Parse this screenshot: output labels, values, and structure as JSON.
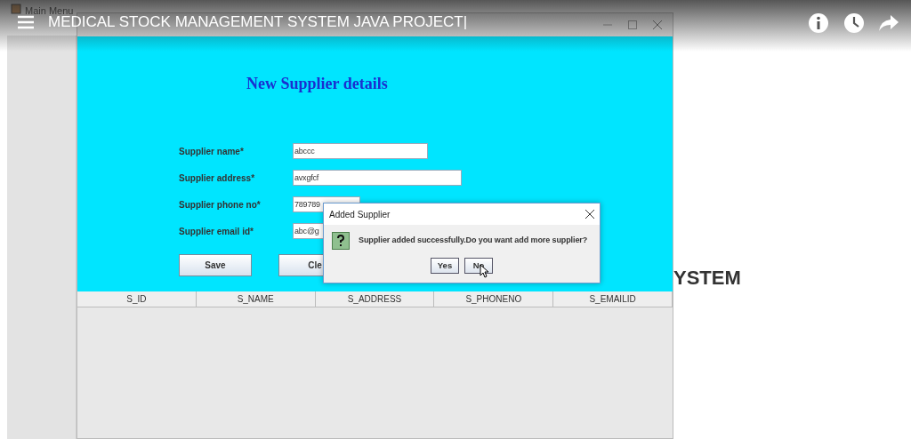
{
  "video": {
    "title": "MEDICAL STOCK MANAGEMENT SYSTEM JAVA PROJECT|"
  },
  "main_window": {
    "title": "Main Menu",
    "heading": "YSTEM"
  },
  "supplier_window": {
    "heading": "New Supplier details",
    "fields": [
      {
        "label": "Supplier name*",
        "value": "abccc"
      },
      {
        "label": "Supplier address*",
        "value": "avxgfcf"
      },
      {
        "label": "Supplier phone no*",
        "value": "789789"
      },
      {
        "label": "Supplier email id*",
        "value": "abc@g"
      }
    ],
    "buttons": [
      "Save",
      "Cle"
    ],
    "table": {
      "columns": [
        "S_ID",
        "S_NAME",
        "S_ADDRESS",
        "S_PHONENO",
        "S_EMAILID"
      ]
    }
  },
  "dialog": {
    "title": "Added Supplier",
    "message": "Supplier added successfully.Do you want add more supplier?",
    "buttons": [
      "Yes",
      "No"
    ]
  }
}
